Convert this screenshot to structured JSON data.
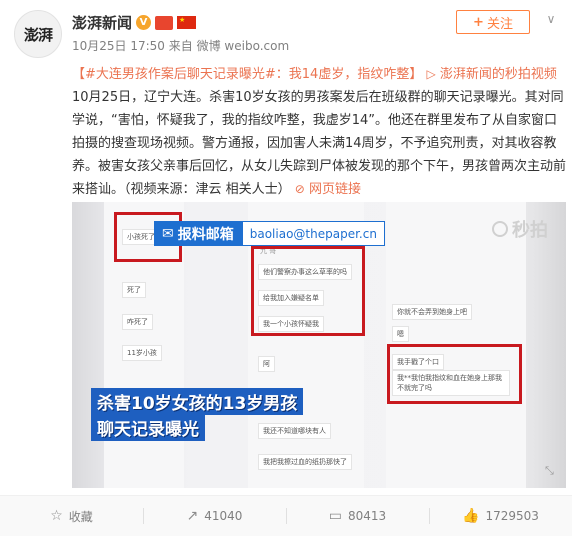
{
  "author": {
    "name": "澎湃新闻",
    "avatar_text": "澎湃",
    "verified_mark": "V"
  },
  "meta": {
    "time": "10月25日 17:50",
    "source_prefix": "来自",
    "source": "微博 weibo.com"
  },
  "follow_button": {
    "plus": "+",
    "label": "关注"
  },
  "dropdown_icon": "∨",
  "post": {
    "topic": "【#大连男孩作案后聊天记录曝光#：我14虚岁，指纹咋整】",
    "video_link_icon": "▷",
    "video_link": "澎湃新闻的秒拍视频",
    "body": " 10月25日，辽宁大连。杀害10岁女孩的男孩案发后在班级群的聊天记录曝光。其对同学说，“害怕，怀疑我了，我的指纹咋整，我虚岁14”。他还在群里发布了从自家窗口拍摄的搜查现场视频。警方通报，因加害人未满14周岁，不予追究刑责，对其收容教养。被害女孩父亲事后回忆，从女儿失踪到尸体被发现的那个下午，男孩曾两次主动前来搭讪。（视频来源：津云 相关人士）",
    "web_link_icon": "⊘",
    "web_link": "网页链接"
  },
  "media": {
    "mailbox_label": "报料邮箱",
    "mailbox_icon": "✉",
    "mailbox_address": "baoliao@thepaper.cn",
    "caption_line1": "杀害10岁女孩的13岁男孩",
    "caption_line2": "聊天记录曝光",
    "watermark": "秒拍",
    "expand_icon": "⤡",
    "chat_messages": [
      "小孩死了",
      "死了",
      "咋死了",
      "11岁小孩",
      "阿",
      "他们警察办事这么草率的吗",
      "给我加入嫌疑名单",
      "我一个小孩怀疑我",
      "我还不知道哪块有人",
      "我把我擦过血的纸扔那快了",
      "我手戳了个口",
      "我**我怕我指纹和血在她身上那我不就完了吗",
      "你就不会弄到她身上吧",
      "嗯",
      "九 哥"
    ]
  },
  "footer": {
    "favorite_icon": "☆",
    "favorite_label": "收藏",
    "share_icon": "↗",
    "share_count": "41040",
    "comment_icon": "▭",
    "comment_count": "80413",
    "like_icon": "👍",
    "like_count": "1729503"
  }
}
